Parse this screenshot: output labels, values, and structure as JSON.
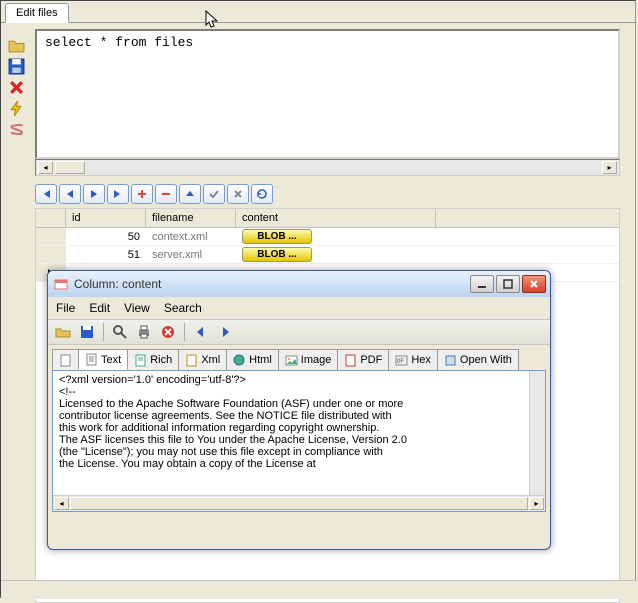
{
  "main": {
    "tab_label": "Edit files",
    "sql_text": "select * from files"
  },
  "nav": {
    "first": "|◀",
    "prev": "◀",
    "next": "▶",
    "last": "▶|",
    "add": "+",
    "remove": "−",
    "up": "▲",
    "commit": "✓",
    "cancel": "✕",
    "refresh": "↻"
  },
  "grid": {
    "headers": {
      "id": "id",
      "filename": "filename",
      "content": "content"
    },
    "rows": [
      {
        "id": "50",
        "filename": "context.xml",
        "content": "BLOB ..."
      },
      {
        "id": "51",
        "filename": "server.xml",
        "content": "BLOB ..."
      }
    ]
  },
  "window": {
    "title": "Column: content",
    "menus": {
      "file": "File",
      "edit": "Edit",
      "view": "View",
      "search": "Search"
    },
    "tabs": {
      "text": "Text",
      "rich": "Rich",
      "xml": "Xml",
      "html": "Html",
      "image": "Image",
      "pdf": "PDF",
      "hex": "Hex",
      "openwith": "Open With"
    },
    "content_lines": [
      "<?xml version='1.0' encoding='utf-8'?>",
      "<!--",
      "  Licensed to the Apache Software Foundation (ASF) under one or more",
      "  contributor license agreements.  See the NOTICE file distributed with",
      "  this work for additional information regarding copyright ownership.",
      "  The ASF licenses this file to You under the Apache License, Version 2.0",
      "  (the \"License\"); you may not use this file except in compliance with",
      "  the License.  You may obtain a copy of the License at"
    ]
  }
}
